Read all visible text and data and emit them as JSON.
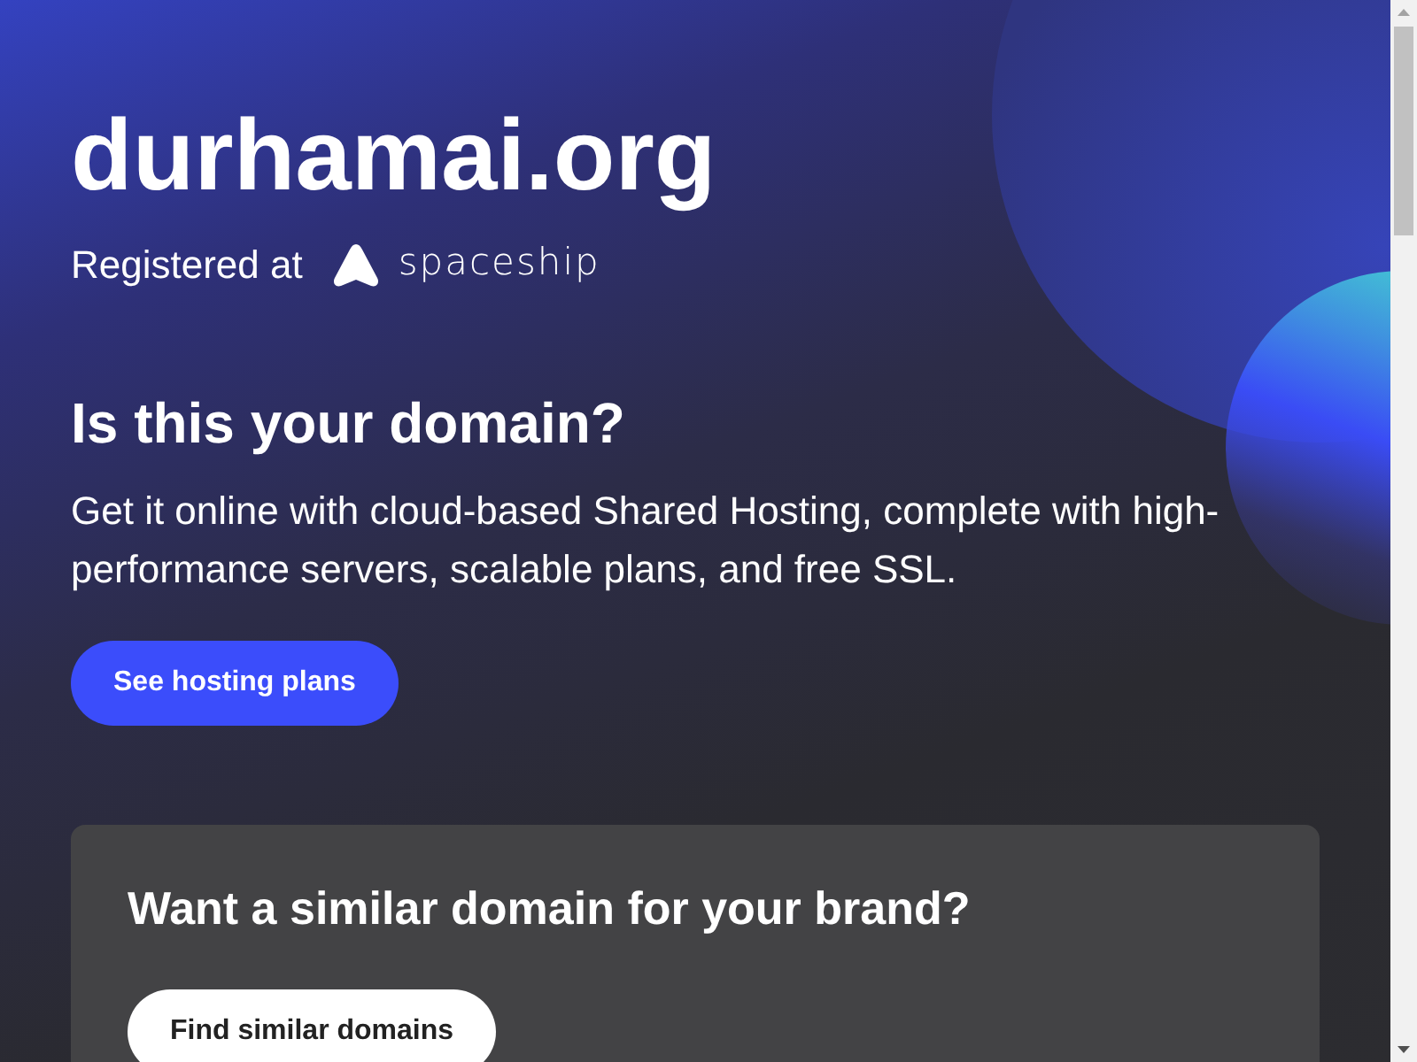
{
  "domain": "durhamai.org",
  "registrar": {
    "label": "Registered at",
    "brand": "spaceship"
  },
  "hero": {
    "heading": "Is this your domain?",
    "text": "Get it online with cloud-based Shared Hosting, complete with high-performance servers, scalable plans, and free SSL.",
    "button": "See hosting plans"
  },
  "card": {
    "heading": "Want a similar domain for your brand?",
    "button": "Find similar domains"
  }
}
